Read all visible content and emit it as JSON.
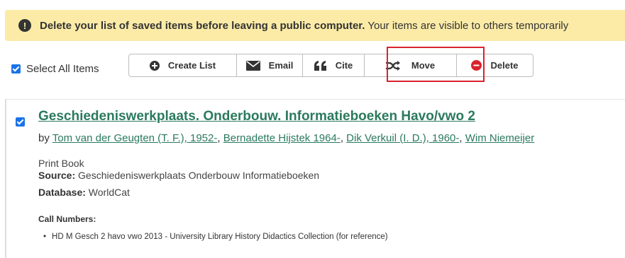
{
  "banner": {
    "bold_text": "Delete your list of saved items before leaving a public computer.",
    "text": " Your items are visible to others temporarily",
    "icon": "exclamation-circle-icon"
  },
  "select_all": {
    "label": "Select All Items",
    "checked": true
  },
  "toolbar": {
    "create_list": "Create List",
    "email": "Email",
    "cite": "Cite",
    "move": "Move",
    "delete": "Delete"
  },
  "item": {
    "checked": true,
    "title": "Geschiedeniswerkplaats. Onderbouw. Informatieboeken Havo/vwo 2",
    "by_label": "by ",
    "authors": [
      "Tom van der Geugten (T. F.), 1952-",
      "Bernadette Hijstek 1964-",
      "Dik Verkuil (I. D.), 1960-",
      "Wim Niemeijer"
    ],
    "format": "Print Book",
    "source_label": "Source:",
    "source": " Geschiedeniswerkplaats Onderbouw Informatieboeken",
    "database_label": "Database:",
    "database": " WorldCat",
    "call_numbers_label": "Call Numbers:",
    "call_numbers": [
      "HD M Gesch 2 havo vwo 2013 - University Library History Didactics Collection (for reference)"
    ]
  },
  "colors": {
    "banner_bg": "#fbeba7",
    "link": "#2b7a5e",
    "highlight": "#d9232d",
    "checkbox": "#1a73e8",
    "delete_icon": "#d9232d"
  }
}
